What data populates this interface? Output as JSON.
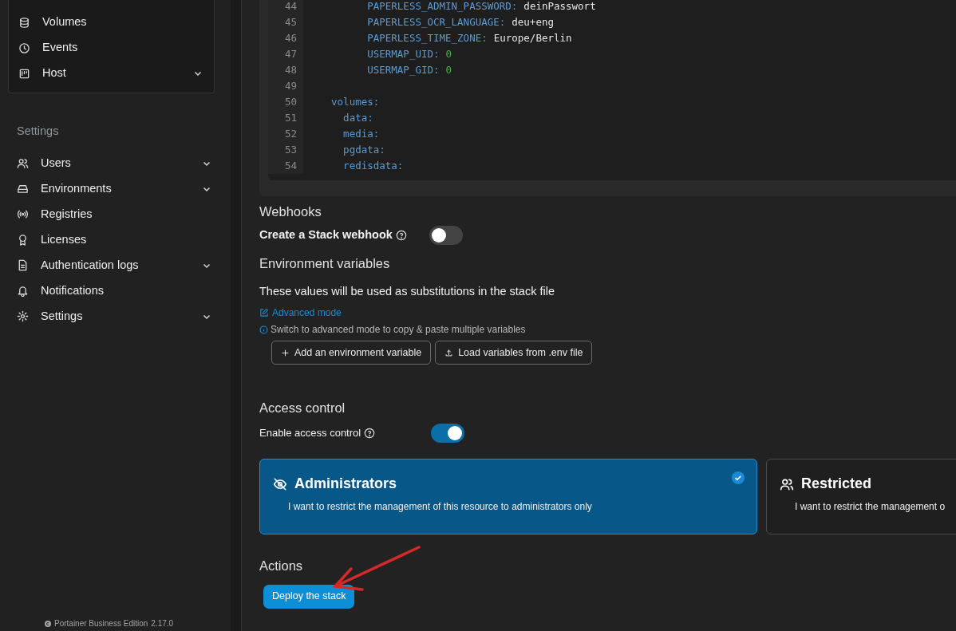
{
  "sidebar": {
    "environment_items": [
      {
        "label": "Volumes",
        "expandable": false
      },
      {
        "label": "Events",
        "expandable": false
      },
      {
        "label": "Host",
        "expandable": true
      }
    ],
    "settings_heading": "Settings",
    "settings_items": [
      {
        "label": "Users",
        "expandable": true
      },
      {
        "label": "Environments",
        "expandable": true
      },
      {
        "label": "Registries",
        "expandable": false
      },
      {
        "label": "Licenses",
        "expandable": false
      },
      {
        "label": "Authentication logs",
        "expandable": true
      },
      {
        "label": "Notifications",
        "expandable": false
      },
      {
        "label": "Settings",
        "expandable": true
      }
    ],
    "footer": "Portainer Business Edition",
    "version": "2.17.0"
  },
  "editor": {
    "lines": [
      {
        "number": "44",
        "key": "        PAPERLESS_ADMIN_PASSWORD:",
        "value": "deinPasswort",
        "kind": "text"
      },
      {
        "number": "45",
        "key": "        PAPERLESS_OCR_LANGUAGE:",
        "value": "deu+eng",
        "kind": "text"
      },
      {
        "number": "46",
        "key": "        PAPERLESS_TIME_ZONE:",
        "value": "Europe/Berlin",
        "kind": "text"
      },
      {
        "number": "47",
        "key": "        USERMAP_UID:",
        "value": "0",
        "kind": "number"
      },
      {
        "number": "48",
        "key": "        USERMAP_GID:",
        "value": "0",
        "kind": "number"
      },
      {
        "number": "49"
      },
      {
        "number": "50",
        "key": "  volumes:"
      },
      {
        "number": "51",
        "key": "    data:"
      },
      {
        "number": "52",
        "key": "    media:"
      },
      {
        "number": "53",
        "key": "    pgdata:"
      },
      {
        "number": "54",
        "key": "    redisdata:"
      }
    ]
  },
  "webhooks": {
    "title": "Webhooks",
    "label": "Create a Stack webhook",
    "on": false
  },
  "environment_variables": {
    "title": "Environment variables",
    "description": "These values will be used as substitutions in the stack file",
    "advanced_link": "Advanced mode",
    "hint": "Switch to advanced mode to copy & paste multiple variables",
    "buttons": [
      "Add an environment variable",
      "Load variables from .env file"
    ]
  },
  "access_control": {
    "title": "Access control",
    "label": "Enable access control",
    "on": true,
    "options": [
      {
        "title": "Administrators",
        "description": "I want to restrict the management of this resource to administrators only",
        "selected": true
      },
      {
        "title": "Restricted",
        "description": "I want to restrict the management o",
        "selected": false
      }
    ]
  },
  "actions": {
    "title": "Actions",
    "button": "Deploy the stack"
  }
}
